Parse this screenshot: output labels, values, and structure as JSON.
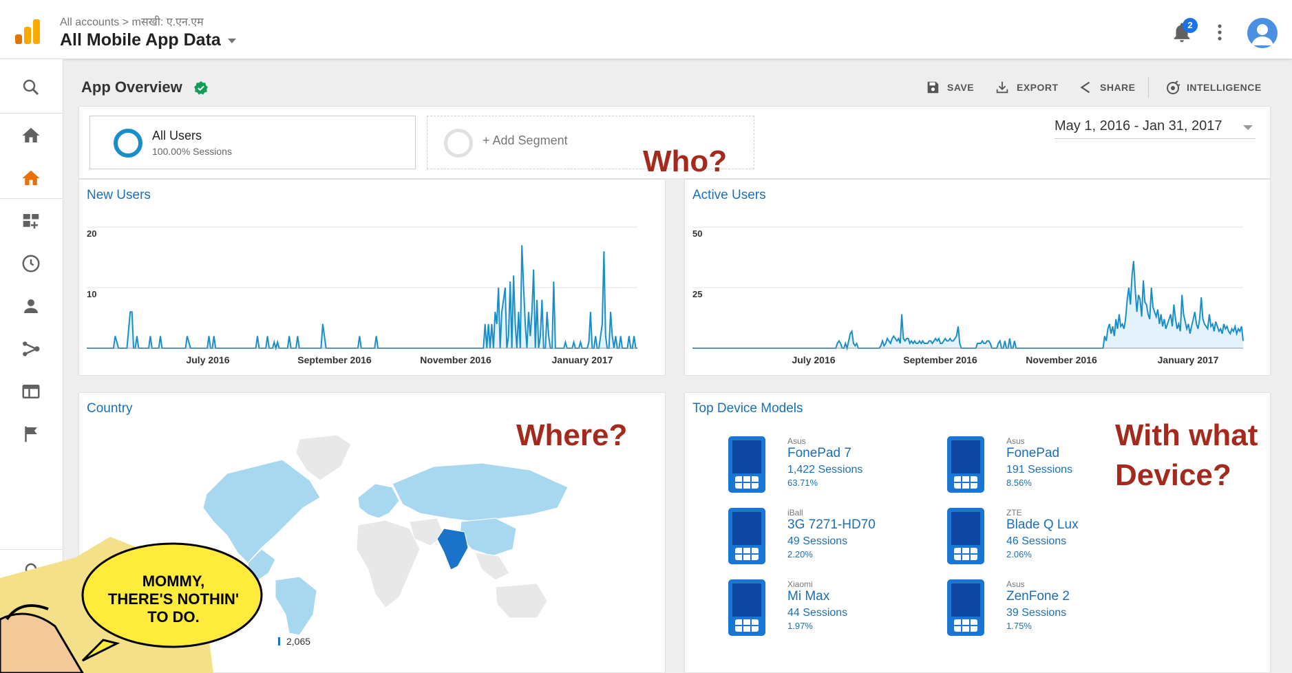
{
  "header": {
    "breadcrumb": "All accounts > mसखी: ए.एन.एम",
    "property": "All Mobile App Data",
    "notification_count": "2"
  },
  "overview": {
    "title": "App Overview",
    "toolbar": {
      "save": "SAVE",
      "export": "EXPORT",
      "share": "SHARE",
      "intelligence": "INTELLIGENCE"
    }
  },
  "segments": {
    "active_name": "All Users",
    "active_sub": "100.00% Sessions",
    "add_label": "+ Add Segment"
  },
  "date_range": "May 1, 2016 - Jan 31, 2017",
  "questions": {
    "who": "Who?",
    "where": "Where?",
    "with_what": "With what",
    "device": "Device?"
  },
  "cards": {
    "new_users": "New Users",
    "active_users": "Active Users",
    "country": "Country",
    "top_devices": "Top Device Models"
  },
  "chart_data": [
    {
      "type": "area",
      "title": "New Users",
      "x_ticks": [
        "July 2016",
        "September 2016",
        "November 2016",
        "January 2017"
      ],
      "y_ticks": [
        "20",
        "10"
      ],
      "ylim": [
        0,
        20
      ],
      "values": [
        0,
        0,
        0,
        0,
        0,
        0,
        0,
        0,
        0,
        0,
        0,
        0,
        0,
        0,
        0,
        0,
        0,
        2,
        1,
        0,
        0,
        0,
        0,
        0,
        0,
        3,
        6,
        6,
        0,
        0,
        2,
        0,
        0,
        0,
        0,
        0,
        0,
        0,
        2,
        0,
        0,
        0,
        0,
        0,
        2,
        0,
        0,
        0,
        0,
        0,
        0,
        0,
        0,
        0,
        0,
        0,
        0,
        0,
        0,
        0,
        2,
        1,
        0,
        0,
        0,
        0,
        0,
        0,
        0,
        0,
        0,
        0,
        0,
        2,
        0,
        0,
        2,
        0,
        0,
        0,
        0,
        0,
        0,
        0,
        0,
        0,
        0,
        0,
        0,
        0,
        0,
        0,
        0,
        0,
        0,
        0,
        0,
        0,
        0,
        0,
        0,
        0,
        2,
        0,
        0,
        0,
        0,
        0,
        2,
        0,
        0,
        0,
        1,
        0,
        1,
        0,
        0,
        0,
        0,
        0,
        0,
        2,
        0,
        0,
        0,
        0,
        2,
        0,
        0,
        0,
        0,
        0,
        0,
        0,
        0,
        0,
        0,
        0,
        0,
        0,
        0,
        4,
        2,
        0,
        0,
        0,
        0,
        0,
        0,
        0,
        0,
        0,
        0,
        0,
        0,
        0,
        0,
        0,
        0,
        0,
        0,
        0,
        0,
        2,
        0,
        0,
        0,
        0,
        0,
        0,
        0,
        0,
        0,
        2,
        0,
        0,
        0,
        0,
        0,
        0,
        0,
        0,
        0,
        0,
        0,
        0,
        0,
        0,
        0,
        0,
        0,
        0,
        0,
        0,
        0,
        0,
        0,
        0,
        0,
        0,
        0,
        0,
        0,
        0,
        0,
        0,
        0,
        0,
        0,
        0,
        0,
        0,
        0,
        0,
        0,
        0,
        0,
        0,
        0,
        0,
        0,
        0,
        0,
        0,
        0,
        0,
        0,
        0,
        0,
        0,
        0,
        0,
        0,
        0,
        0,
        0,
        0,
        0,
        4,
        0,
        4,
        0,
        4,
        0,
        6,
        4,
        10,
        0,
        6,
        8,
        10,
        0,
        2,
        11,
        0,
        12,
        4,
        0,
        6,
        0,
        17,
        10,
        4,
        0,
        6,
        2,
        6,
        13,
        0,
        8,
        0,
        2,
        8,
        0,
        0,
        6,
        2,
        0,
        0,
        11,
        0,
        0,
        0,
        0,
        0,
        0,
        1,
        0,
        0,
        0,
        0,
        1,
        0,
        0,
        0,
        1,
        0,
        0,
        0,
        0,
        1,
        6,
        0,
        0,
        2,
        0,
        0,
        2,
        4,
        16,
        2,
        0,
        0,
        6,
        2,
        0,
        2,
        0,
        0,
        2,
        0,
        0,
        0,
        0,
        2,
        0,
        0,
        2,
        0,
        0
      ]
    },
    {
      "type": "area",
      "title": "Active Users",
      "x_ticks": [
        "July 2016",
        "September 2016",
        "November 2016",
        "January 2017"
      ],
      "y_ticks": [
        "50",
        "25"
      ],
      "ylim": [
        0,
        50
      ],
      "values": [
        0,
        0,
        0,
        0,
        0,
        0,
        0,
        0,
        0,
        0,
        0,
        0,
        0,
        0,
        0,
        0,
        0,
        0,
        0,
        0,
        0,
        0,
        0,
        0,
        0,
        0,
        0,
        0,
        0,
        0,
        0,
        0,
        0,
        0,
        0,
        0,
        0,
        0,
        0,
        0,
        0,
        0,
        0,
        0,
        0,
        0,
        0,
        0,
        0,
        0,
        0,
        0,
        0,
        0,
        0,
        0,
        0,
        0,
        0,
        0,
        0,
        0,
        0,
        0,
        0,
        0,
        0,
        0,
        0,
        0,
        0,
        0,
        0,
        0,
        0,
        0,
        0,
        0,
        0,
        0,
        0,
        0,
        0,
        0,
        0,
        0,
        0,
        0,
        0,
        0,
        2,
        3,
        2,
        0,
        0,
        2,
        0,
        3,
        6,
        7,
        2,
        1,
        2,
        0,
        0,
        0,
        0,
        0,
        0,
        0,
        0,
        0,
        0,
        0,
        0,
        0,
        0,
        1,
        3,
        1,
        2,
        4,
        3,
        2,
        4,
        5,
        4,
        3,
        4,
        2,
        14,
        4,
        3,
        4,
        4,
        2,
        3,
        2,
        3,
        2,
        2,
        3,
        2,
        3,
        2,
        2,
        2,
        3,
        3,
        2,
        3,
        4,
        3,
        4,
        2,
        2,
        3,
        4,
        3,
        3,
        4,
        3,
        3,
        4,
        5,
        9,
        2,
        0,
        0,
        0,
        0,
        0,
        0,
        0,
        0,
        0,
        0,
        2,
        2,
        2,
        3,
        2,
        2,
        3,
        3,
        2,
        0,
        0,
        0,
        0,
        2,
        3,
        0,
        0,
        3,
        0,
        0,
        4,
        0,
        0,
        3,
        0,
        0,
        0,
        0,
        0,
        0,
        0,
        0,
        0,
        0,
        0,
        0,
        0,
        0,
        0,
        0,
        0,
        0,
        0,
        0,
        0,
        0,
        0,
        0,
        0,
        0,
        0,
        0,
        0,
        0,
        0,
        0,
        0,
        0,
        0,
        0,
        0,
        0,
        0,
        0,
        0,
        0,
        0,
        0,
        0,
        0,
        0,
        0,
        0,
        0,
        0,
        0,
        0,
        0,
        0,
        5,
        3,
        8,
        10,
        6,
        9,
        5,
        12,
        8,
        14,
        9,
        10,
        8,
        12,
        20,
        25,
        18,
        30,
        36,
        24,
        15,
        22,
        20,
        13,
        28,
        19,
        18,
        14,
        12,
        25,
        17,
        15,
        13,
        16,
        10,
        14,
        9,
        12,
        8,
        10,
        12,
        14,
        9,
        18,
        12,
        8,
        10,
        7,
        22,
        14,
        11,
        8,
        10,
        6,
        9,
        12,
        15,
        10,
        8,
        12,
        21,
        12,
        10,
        9,
        8,
        14,
        9,
        10,
        7,
        11,
        9,
        7,
        8,
        6,
        10,
        8,
        9,
        7,
        6,
        8,
        7,
        9,
        6,
        8,
        7,
        9,
        3
      ]
    }
  ],
  "map": {
    "legend_max": "2,065"
  },
  "devices": [
    {
      "brand": "Asus",
      "model": "FonePad 7",
      "sessions": "1,422 Sessions",
      "pct": "63.71%"
    },
    {
      "brand": "Asus",
      "model": "FonePad",
      "sessions": "191 Sessions",
      "pct": "8.56%"
    },
    {
      "brand": "iBall",
      "model": "3G 7271-HD70",
      "sessions": "49 Sessions",
      "pct": "2.20%"
    },
    {
      "brand": "ZTE",
      "model": "Blade Q Lux",
      "sessions": "46 Sessions",
      "pct": "2.06%"
    },
    {
      "brand": "Xiaomi",
      "model": "Mi Max",
      "sessions": "44 Sessions",
      "pct": "1.97%"
    },
    {
      "brand": "Asus",
      "model": "ZenFone 2",
      "sessions": "39 Sessions",
      "pct": "1.75%"
    }
  ],
  "comic": {
    "line1": "MOMMY,",
    "line2": "THERE'S NOTHIN'",
    "line3": "TO DO."
  },
  "colors": {
    "accent": "#1a8ec8",
    "question": "#a52a1e",
    "link": "#1a6fb5",
    "map_fill": "#a8d8f0",
    "map_highlight": "#1a73c8"
  }
}
